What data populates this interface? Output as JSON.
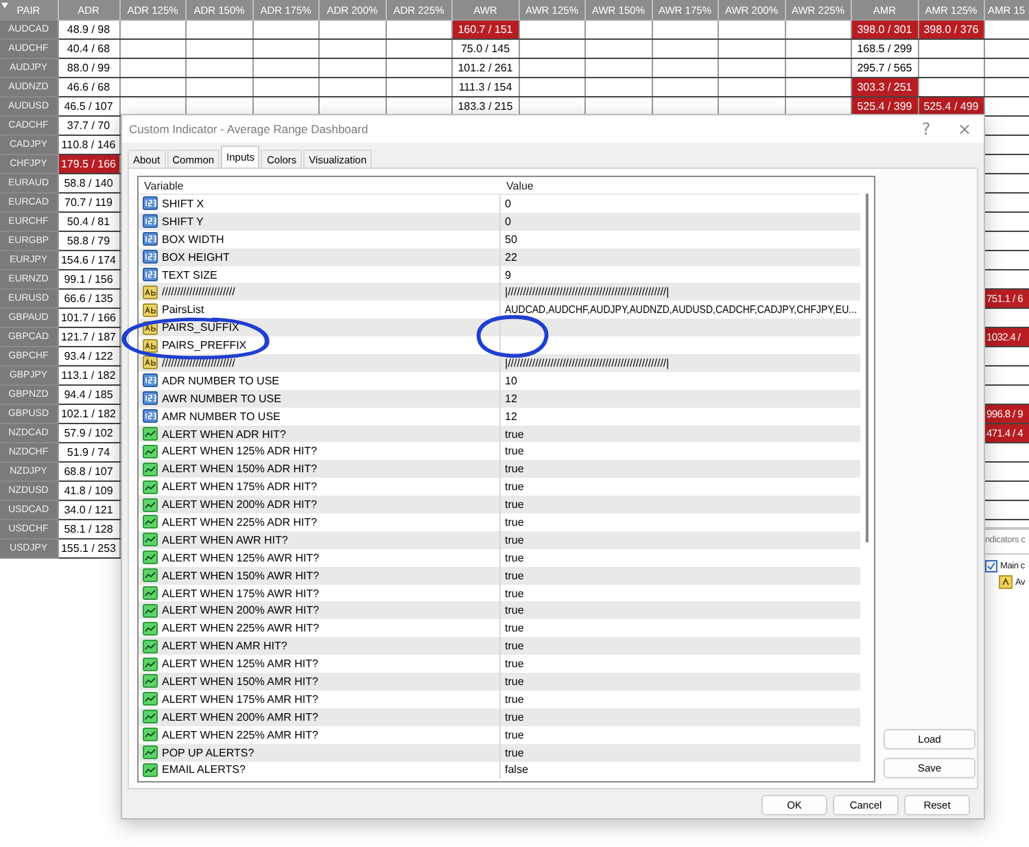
{
  "dashboard": {
    "pair_header": "PAIR",
    "columns": [
      "ADR",
      "ADR 125%",
      "ADR 150%",
      "ADR 175%",
      "ADR 200%",
      "ADR 225%",
      "AWR",
      "AWR 125%",
      "AWR 150%",
      "AWR 175%",
      "AWR 200%",
      "AWR 225%",
      "AMR",
      "AMR 125%",
      "AMR 15"
    ],
    "rows": [
      {
        "pair": "AUDCAD",
        "cells": [
          {
            "text": "48.9 / 98",
            "hit": false
          },
          {},
          {},
          {},
          {},
          {},
          {
            "text": "160.7 / 151",
            "hit": true
          },
          {},
          {},
          {},
          {},
          {},
          {
            "text": "398.0 / 301",
            "hit": true
          },
          {
            "text": "398.0 / 376",
            "hit": true
          },
          {}
        ]
      },
      {
        "pair": "AUDCHF",
        "cells": [
          {
            "text": "40.4 / 68",
            "hit": false
          },
          {},
          {},
          {},
          {},
          {},
          {
            "text": "75.0 / 145",
            "hit": false
          },
          {},
          {},
          {},
          {},
          {},
          {
            "text": "168.5 / 299",
            "hit": false
          },
          {},
          {}
        ]
      },
      {
        "pair": "AUDJPY",
        "cells": [
          {
            "text": "88.0 / 99",
            "hit": false
          },
          {},
          {},
          {},
          {},
          {},
          {
            "text": "101.2 / 261",
            "hit": false
          },
          {},
          {},
          {},
          {},
          {},
          {
            "text": "295.7 / 565",
            "hit": false
          },
          {},
          {}
        ]
      },
      {
        "pair": "AUDNZD",
        "cells": [
          {
            "text": "46.6 / 68",
            "hit": false
          },
          {},
          {},
          {},
          {},
          {},
          {
            "text": "111.3 / 154",
            "hit": false
          },
          {},
          {},
          {},
          {},
          {},
          {
            "text": "303.3 / 251",
            "hit": true
          },
          {},
          {}
        ]
      },
      {
        "pair": "AUDUSD",
        "cells": [
          {
            "text": "46.5 / 107",
            "hit": false
          },
          {},
          {},
          {},
          {},
          {},
          {
            "text": "183.3 / 215",
            "hit": false
          },
          {},
          {},
          {},
          {},
          {},
          {
            "text": "525.4 / 399",
            "hit": true
          },
          {
            "text": "525.4 / 499",
            "hit": true
          },
          {}
        ]
      },
      {
        "pair": "CADCHF",
        "cells": [
          {
            "text": "37.7 / 70",
            "hit": false
          }
        ]
      },
      {
        "pair": "CADJPY",
        "cells": [
          {
            "text": "110.8 / 146",
            "hit": false
          }
        ]
      },
      {
        "pair": "CHFJPY",
        "cells": [
          {
            "text": "179.5 / 166",
            "hit": true
          }
        ]
      },
      {
        "pair": "EURAUD",
        "cells": [
          {
            "text": "58.8 / 140",
            "hit": false
          }
        ]
      },
      {
        "pair": "EURCAD",
        "cells": [
          {
            "text": "70.7 / 119",
            "hit": false
          }
        ]
      },
      {
        "pair": "EURCHF",
        "cells": [
          {
            "text": "50.4 / 81",
            "hit": false
          }
        ]
      },
      {
        "pair": "EURGBP",
        "cells": [
          {
            "text": "58.8 / 79",
            "hit": false
          }
        ]
      },
      {
        "pair": "EURJPY",
        "cells": [
          {
            "text": "154.6 / 174",
            "hit": false
          }
        ]
      },
      {
        "pair": "EURNZD",
        "cells": [
          {
            "text": "99.1 / 156",
            "hit": false
          }
        ]
      },
      {
        "pair": "EURUSD",
        "cells": [
          {
            "text": "66.6 / 135",
            "hit": false
          },
          {},
          {},
          {},
          {},
          {},
          {},
          {},
          {},
          {},
          {},
          {},
          {},
          {},
          {
            "text": "751.1 / 6",
            "hit": true
          }
        ]
      },
      {
        "pair": "GBPAUD",
        "cells": [
          {
            "text": "101.7 / 166",
            "hit": false
          }
        ]
      },
      {
        "pair": "GBPCAD",
        "cells": [
          {
            "text": "121.7 / 187",
            "hit": false
          },
          {},
          {},
          {},
          {},
          {},
          {},
          {},
          {},
          {},
          {},
          {},
          {},
          {},
          {
            "text": "1032.4 /",
            "hit": true
          }
        ]
      },
      {
        "pair": "GBPCHF",
        "cells": [
          {
            "text": "93.4 / 122",
            "hit": false
          }
        ]
      },
      {
        "pair": "GBPJPY",
        "cells": [
          {
            "text": "113.1 / 182",
            "hit": false
          }
        ]
      },
      {
        "pair": "GBPNZD",
        "cells": [
          {
            "text": "94.4 / 185",
            "hit": false
          }
        ]
      },
      {
        "pair": "GBPUSD",
        "cells": [
          {
            "text": "102.1 / 182",
            "hit": false
          },
          {},
          {},
          {},
          {},
          {},
          {},
          {},
          {},
          {},
          {},
          {},
          {},
          {},
          {
            "text": "996.8 / 9",
            "hit": true
          }
        ]
      },
      {
        "pair": "NZDCAD",
        "cells": [
          {
            "text": "57.9 / 102",
            "hit": false
          },
          {},
          {},
          {},
          {},
          {},
          {},
          {},
          {},
          {},
          {},
          {},
          {},
          {},
          {
            "text": "471.4 / 4",
            "hit": true
          }
        ]
      },
      {
        "pair": "NZDCHF",
        "cells": [
          {
            "text": "51.9 / 74",
            "hit": false
          }
        ]
      },
      {
        "pair": "NZDJPY",
        "cells": [
          {
            "text": "68.8 / 107",
            "hit": false
          }
        ]
      },
      {
        "pair": "NZDUSD",
        "cells": [
          {
            "text": "41.8 / 109",
            "hit": false
          }
        ]
      },
      {
        "pair": "USDCAD",
        "cells": [
          {
            "text": "34.0 / 121",
            "hit": false
          }
        ]
      },
      {
        "pair": "USDCHF",
        "cells": [
          {
            "text": "58.1 / 128",
            "hit": false
          }
        ]
      },
      {
        "pair": "USDJPY",
        "cells": [
          {
            "text": "155.1 / 253",
            "hit": false
          }
        ]
      }
    ]
  },
  "navigator": {
    "title": "ndicators c",
    "items": [
      {
        "label": "Main c",
        "kind": "chart"
      },
      {
        "label": "Av",
        "kind": "indicator"
      }
    ]
  },
  "dialog": {
    "title": "Custom Indicator - Average Range Dashboard",
    "help": "?",
    "close": "×",
    "tabs": [
      {
        "label": "About",
        "selected": false
      },
      {
        "label": "Common",
        "selected": false
      },
      {
        "label": "Inputs",
        "selected": true
      },
      {
        "label": "Colors",
        "selected": false
      },
      {
        "label": "Visualization",
        "selected": false
      }
    ],
    "columns": [
      "Variable",
      "Value"
    ],
    "rows": [
      {
        "kind": "int",
        "variable": "SHIFT X",
        "value": "0"
      },
      {
        "kind": "int",
        "variable": "SHIFT Y",
        "value": "0"
      },
      {
        "kind": "int",
        "variable": "BOX WIDTH",
        "value": "50"
      },
      {
        "kind": "int",
        "variable": "BOX HEIGHT",
        "value": "22"
      },
      {
        "kind": "int",
        "variable": "TEXT SIZE",
        "value": "9"
      },
      {
        "kind": "string",
        "variable": "////////////////////////",
        "value": "|////////////////////////////////////////////////////|"
      },
      {
        "kind": "string",
        "variable": "PairsList",
        "value": "AUDCAD,AUDCHF,AUDJPY,AUDNZD,AUDUSD,CADCHF,CADJPY,CHFJPY,EU..."
      },
      {
        "kind": "string",
        "variable": "PAIRS_SUFFIX"
      },
      {
        "kind": "string",
        "variable": "PAIRS_PREFFIX"
      },
      {
        "kind": "string",
        "variable": "////////////////////////",
        "value": "|////////////////////////////////////////////////////|"
      },
      {
        "kind": "int",
        "variable": "ADR NUMBER TO USE",
        "value": "10"
      },
      {
        "kind": "int",
        "variable": "AWR NUMBER TO USE",
        "value": "12"
      },
      {
        "kind": "int",
        "variable": "AMR NUMBER TO USE",
        "value": "12"
      },
      {
        "kind": "bool",
        "variable": "ALERT WHEN ADR HIT?",
        "value": "true"
      },
      {
        "kind": "bool",
        "variable": "ALERT WHEN 125% ADR HIT?",
        "value": "true"
      },
      {
        "kind": "bool",
        "variable": "ALERT WHEN 150% ADR HIT?",
        "value": "true"
      },
      {
        "kind": "bool",
        "variable": "ALERT WHEN 175% ADR HIT?",
        "value": "true"
      },
      {
        "kind": "bool",
        "variable": "ALERT WHEN 200% ADR HIT?",
        "value": "true"
      },
      {
        "kind": "bool",
        "variable": "ALERT WHEN 225% ADR HIT?",
        "value": "true"
      },
      {
        "kind": "bool",
        "variable": "ALERT WHEN AWR HIT?",
        "value": "true"
      },
      {
        "kind": "bool",
        "variable": "ALERT WHEN 125% AWR HIT?",
        "value": "true"
      },
      {
        "kind": "bool",
        "variable": "ALERT WHEN 150% AWR HIT?",
        "value": "true"
      },
      {
        "kind": "bool",
        "variable": "ALERT WHEN 175% AWR HIT?",
        "value": "true"
      },
      {
        "kind": "bool",
        "variable": "ALERT WHEN 200% AWR HIT?",
        "value": "true"
      },
      {
        "kind": "bool",
        "variable": "ALERT WHEN 225% AWR HIT?",
        "value": "true"
      },
      {
        "kind": "bool",
        "variable": "ALERT WHEN AMR HIT?",
        "value": "true"
      },
      {
        "kind": "bool",
        "variable": "ALERT WHEN 125% AMR HIT?",
        "value": "true"
      },
      {
        "kind": "bool",
        "variable": "ALERT WHEN 150% AMR HIT?",
        "value": "true"
      },
      {
        "kind": "bool",
        "variable": "ALERT WHEN 175% AMR HIT?",
        "value": "true"
      },
      {
        "kind": "bool",
        "variable": "ALERT WHEN 200% AMR HIT?",
        "value": "true"
      },
      {
        "kind": "bool",
        "variable": "ALERT WHEN 225% AMR HIT?",
        "value": "true"
      },
      {
        "kind": "bool",
        "variable": "POP UP ALERTS?",
        "value": "true"
      },
      {
        "kind": "bool",
        "variable": "EMAIL ALERTS?",
        "value": "false"
      }
    ],
    "side_buttons": [
      "Load",
      "Save"
    ],
    "buttons": [
      "OK",
      "Cancel",
      "Reset"
    ]
  }
}
